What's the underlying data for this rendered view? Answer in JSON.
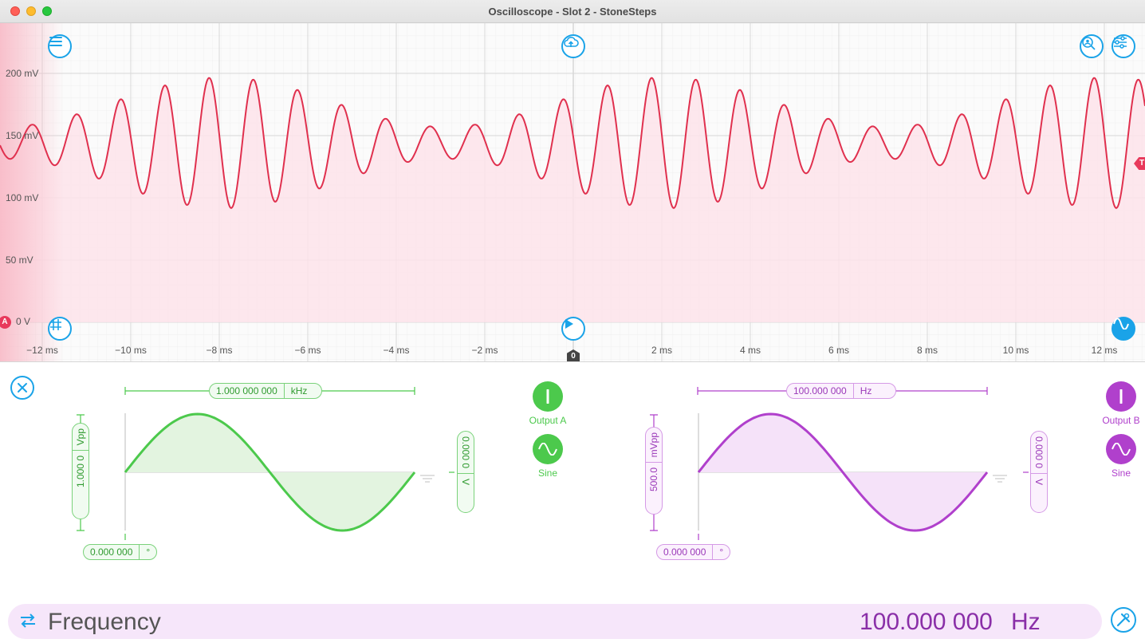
{
  "window": {
    "title": "Oscilloscope - Slot 2 - StoneSteps"
  },
  "scope": {
    "y_ticks": [
      "200 mV",
      "150 mV",
      "100 mV",
      "50 mV",
      "0 V"
    ],
    "x_ticks": [
      "−12 ms",
      "−10 ms",
      "−8 ms",
      "−6 ms",
      "−4 ms",
      "−2 ms",
      "2 ms",
      "4 ms",
      "6 ms",
      "8 ms",
      "10 ms",
      "12 ms"
    ],
    "trace_color": "#e0304e",
    "fill_color": "#fde3ea",
    "accent_color": "#1aa3e8",
    "channel_marker": "A",
    "trigger_marker": "T",
    "time_marker": "0",
    "buttons": {
      "menu": "menu-icon",
      "cloud": "cloud-upload-icon",
      "zoom": "zoom-person-icon",
      "settings": "sliders-icon",
      "grid": "grid-icon",
      "play": "play-icon",
      "wave": "sine-wave-icon"
    }
  },
  "output_a": {
    "label": "Output A",
    "wave_label": "Sine",
    "frequency": "1.000 000 000",
    "frequency_unit": "kHz",
    "amplitude": "1.000 0",
    "amplitude_unit": "Vpp",
    "offset": "0.000 0",
    "offset_unit": "V",
    "phase": "0.000 000",
    "phase_unit": "°",
    "color": "#4cc94c"
  },
  "output_b": {
    "label": "Output B",
    "wave_label": "Sine",
    "frequency": "100.000 000",
    "frequency_unit": "Hz",
    "amplitude": "500.0",
    "amplitude_unit": "mVpp",
    "offset": "0.000 0",
    "offset_unit": "V",
    "phase": "0.000 000",
    "phase_unit": "°",
    "color": "#b040cc"
  },
  "frequency_bar": {
    "label": "Frequency",
    "value": "100.000 000",
    "unit": "Hz"
  }
}
